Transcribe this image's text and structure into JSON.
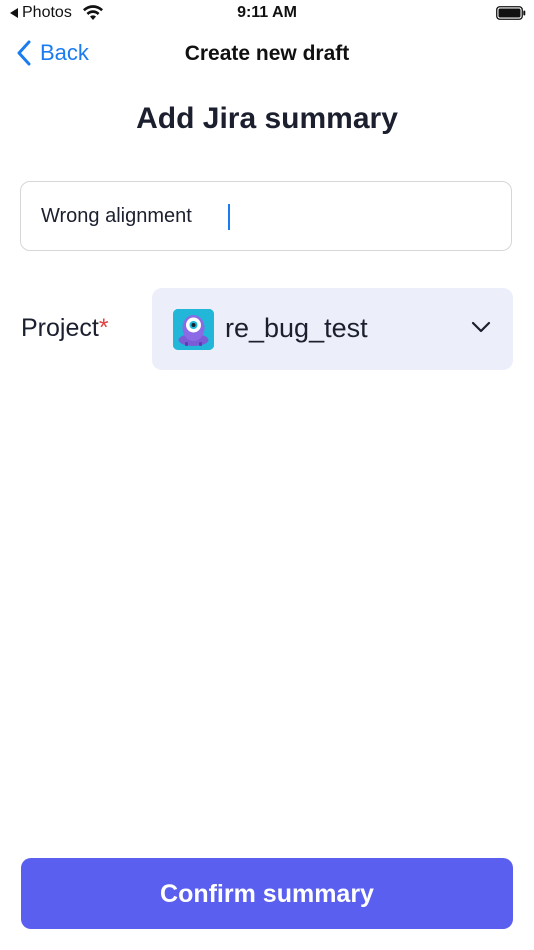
{
  "status_bar": {
    "back_app": "Photos",
    "time": "9:11 AM"
  },
  "nav": {
    "back_label": "Back",
    "title": "Create new draft"
  },
  "heading": "Add Jira summary",
  "summary": {
    "value": "Wrong alignment",
    "placeholder": ""
  },
  "project": {
    "label": "Project",
    "required_mark": "*",
    "selected": "re_bug_test",
    "avatar_icon": "robot-avatar-icon"
  },
  "confirm_button": {
    "label": "Confirm summary"
  },
  "colors": {
    "accent": "#1a7cf0",
    "primary_button": "#5a5ff0",
    "select_bg": "#eceef9",
    "required": "#e04545",
    "avatar_bg": "#22b6d8"
  }
}
